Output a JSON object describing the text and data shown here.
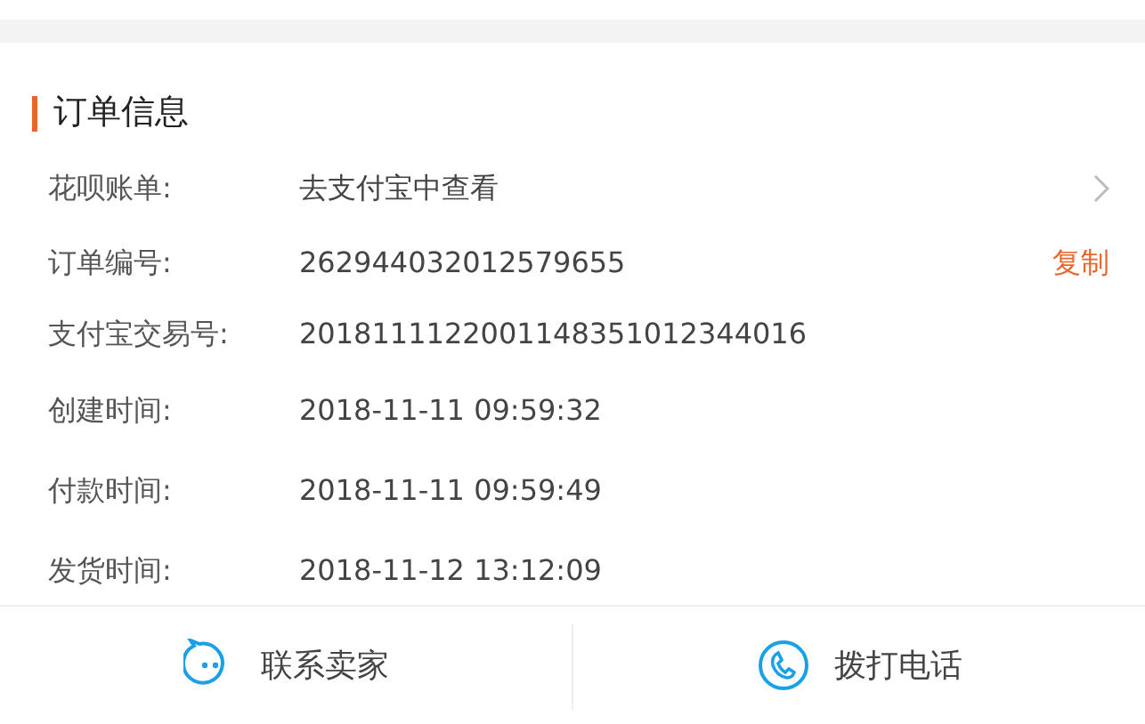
{
  "section": {
    "title": "订单信息"
  },
  "rows": [
    {
      "label": "花呗账单:",
      "value": "去支付宝中查看",
      "kind": "link"
    },
    {
      "label": "订单编号:",
      "value": "262944032012579655",
      "kind": "copy",
      "action": "复制"
    },
    {
      "label": "支付宝交易号:",
      "value": "2018111122001148351012344016",
      "kind": "plain"
    },
    {
      "label": "创建时间:",
      "value": "2018-11-11 09:59:32",
      "kind": "plain"
    },
    {
      "label": "付款时间:",
      "value": "2018-11-11 09:59:49",
      "kind": "plain"
    },
    {
      "label": "发货时间:",
      "value": "2018-11-12 13:12:09",
      "kind": "plain"
    }
  ],
  "actions": [
    {
      "label": "联系卖家",
      "kind": "chat"
    },
    {
      "label": "拨打电话",
      "kind": "phone"
    }
  ]
}
